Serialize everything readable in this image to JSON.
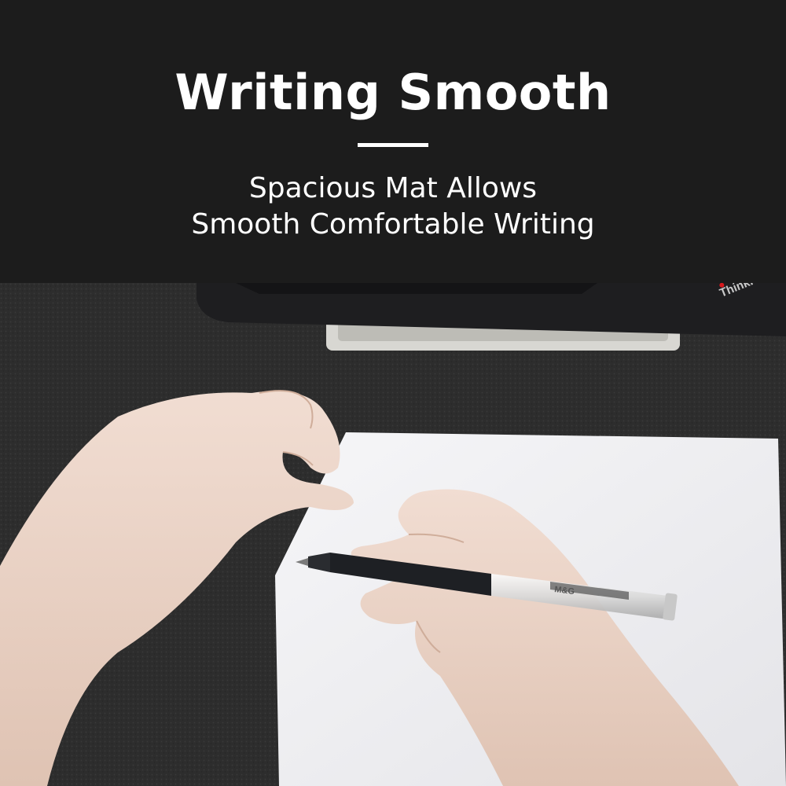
{
  "banner": {
    "title": "Writing Smooth",
    "subtitle_line_1": "Spacious Mat Allows",
    "subtitle_line_2": "Smooth Comfortable Writing"
  },
  "photo": {
    "laptop_badge": "ThinkPad",
    "pen_barrel_text": "M&G"
  },
  "colors": {
    "banner_background": "#1c1c1c",
    "banner_text": "#ffffff",
    "desk_mat": "#2e2e2e",
    "paper": "#f1f1f3",
    "skin": "#ead3c6",
    "pen_grip": "#1e2024",
    "laptop_badge_red": "#d7191d"
  }
}
